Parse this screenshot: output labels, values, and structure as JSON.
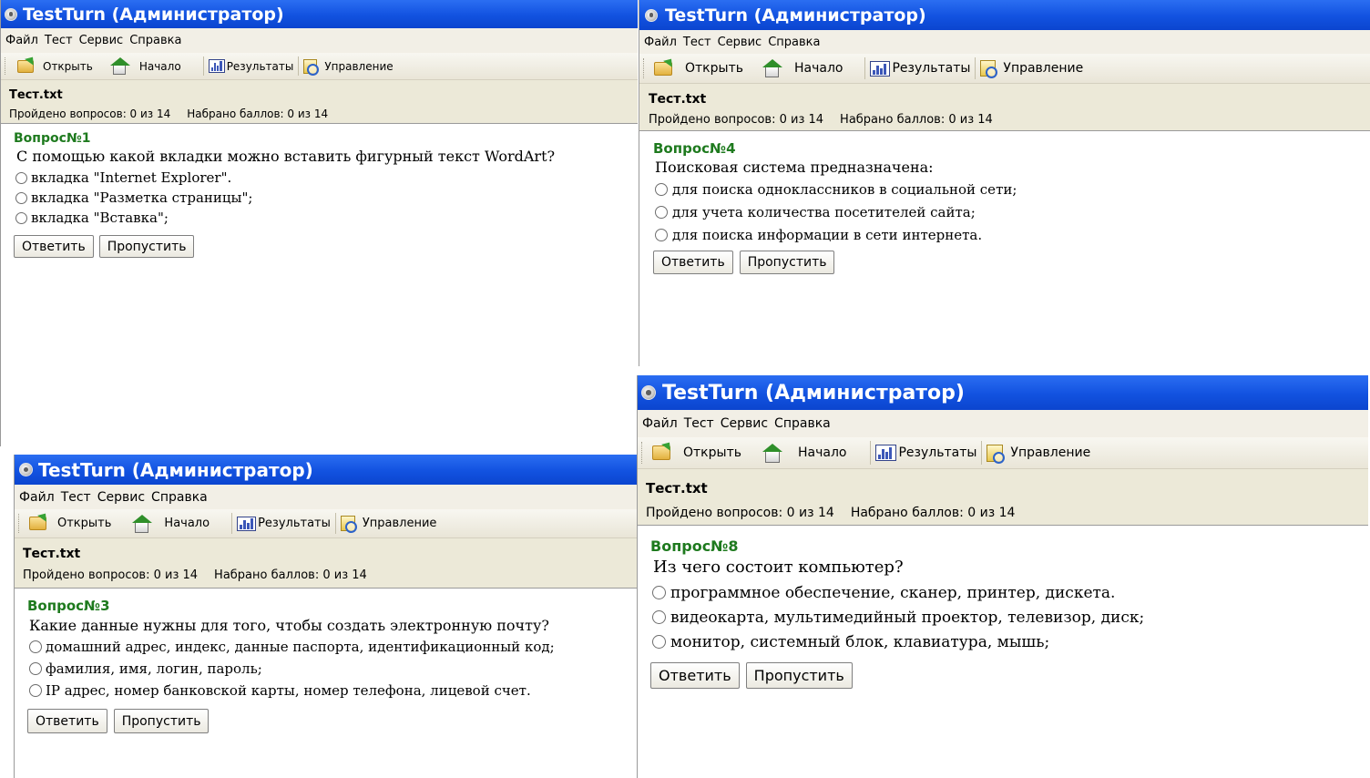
{
  "app": {
    "title": "TestTurn (Администратор)",
    "menu": [
      "Файл",
      "Тест",
      "Сервис",
      "Справка"
    ],
    "toolbar": {
      "open": "Открыть",
      "home": "Начало",
      "results": "Результаты",
      "manage": "Управление"
    },
    "file": "Тест.txt",
    "progress": "Пройдено вопросов: 0 из 14",
    "score": "Набрано баллов: 0 из 14",
    "answer_label": "Ответить",
    "skip_label": "Пропустить"
  },
  "windows": [
    {
      "question_number": "Вопрос№1",
      "question": "С помощью какой вкладки можно вставить фигурный текст WordArt?",
      "options": [
        "вкладка \"Internet Explorer\".",
        "вкладка \"Разметка страницы\";",
        "вкладка \"Вставка\";"
      ]
    },
    {
      "question_number": "Вопрос№4",
      "question": "Поисковая система предназначена:",
      "options": [
        "для поиска одноклассников в социальной сети;",
        "для учета количества посетителей сайта;",
        "для поиска информации в сети интернета."
      ]
    },
    {
      "question_number": "Вопрос№3",
      "question": "Какие данные нужны для того, чтобы создать электронную почту?",
      "options": [
        "домашний адрес, индекс, данные паспорта, идентификационный код;",
        "фамилия, имя, логин, пароль;",
        "IP адрес, номер банковской карты, номер телефона, лицевой счет."
      ]
    },
    {
      "question_number": "Вопрос№8",
      "question": "Из чего состоит компьютер?",
      "options": [
        "программное обеспечение, сканер, принтер, дискета.",
        "видеокарта, мультимедийный проектор, телевизор, диск;",
        "монитор, системный блок, клавиатура, мышь;"
      ]
    }
  ],
  "colors": {
    "titlebar": "#1252e0",
    "question_number": "#1e7a1e",
    "infobar": "#ece9d8"
  }
}
